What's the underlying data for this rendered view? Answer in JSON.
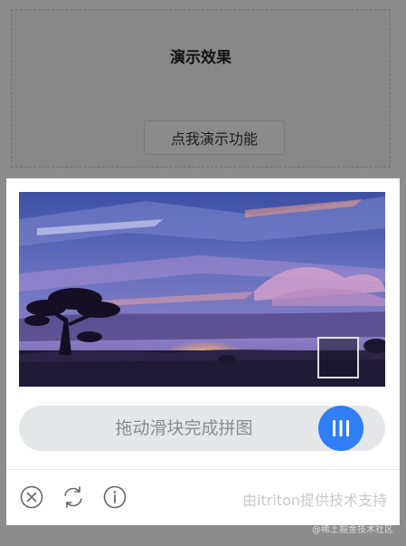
{
  "demo": {
    "title": "演示效果",
    "button_label": "点我演示功能"
  },
  "captcha": {
    "slider_hint": "拖动滑块完成拼图",
    "credit": "由itriton提供技术支持",
    "accent_color": "#2f7ef5",
    "tools": [
      {
        "icon": "close-circle-icon"
      },
      {
        "icon": "refresh-icon"
      },
      {
        "icon": "info-icon"
      }
    ]
  },
  "watermark": "@稀土掘金技术社区"
}
